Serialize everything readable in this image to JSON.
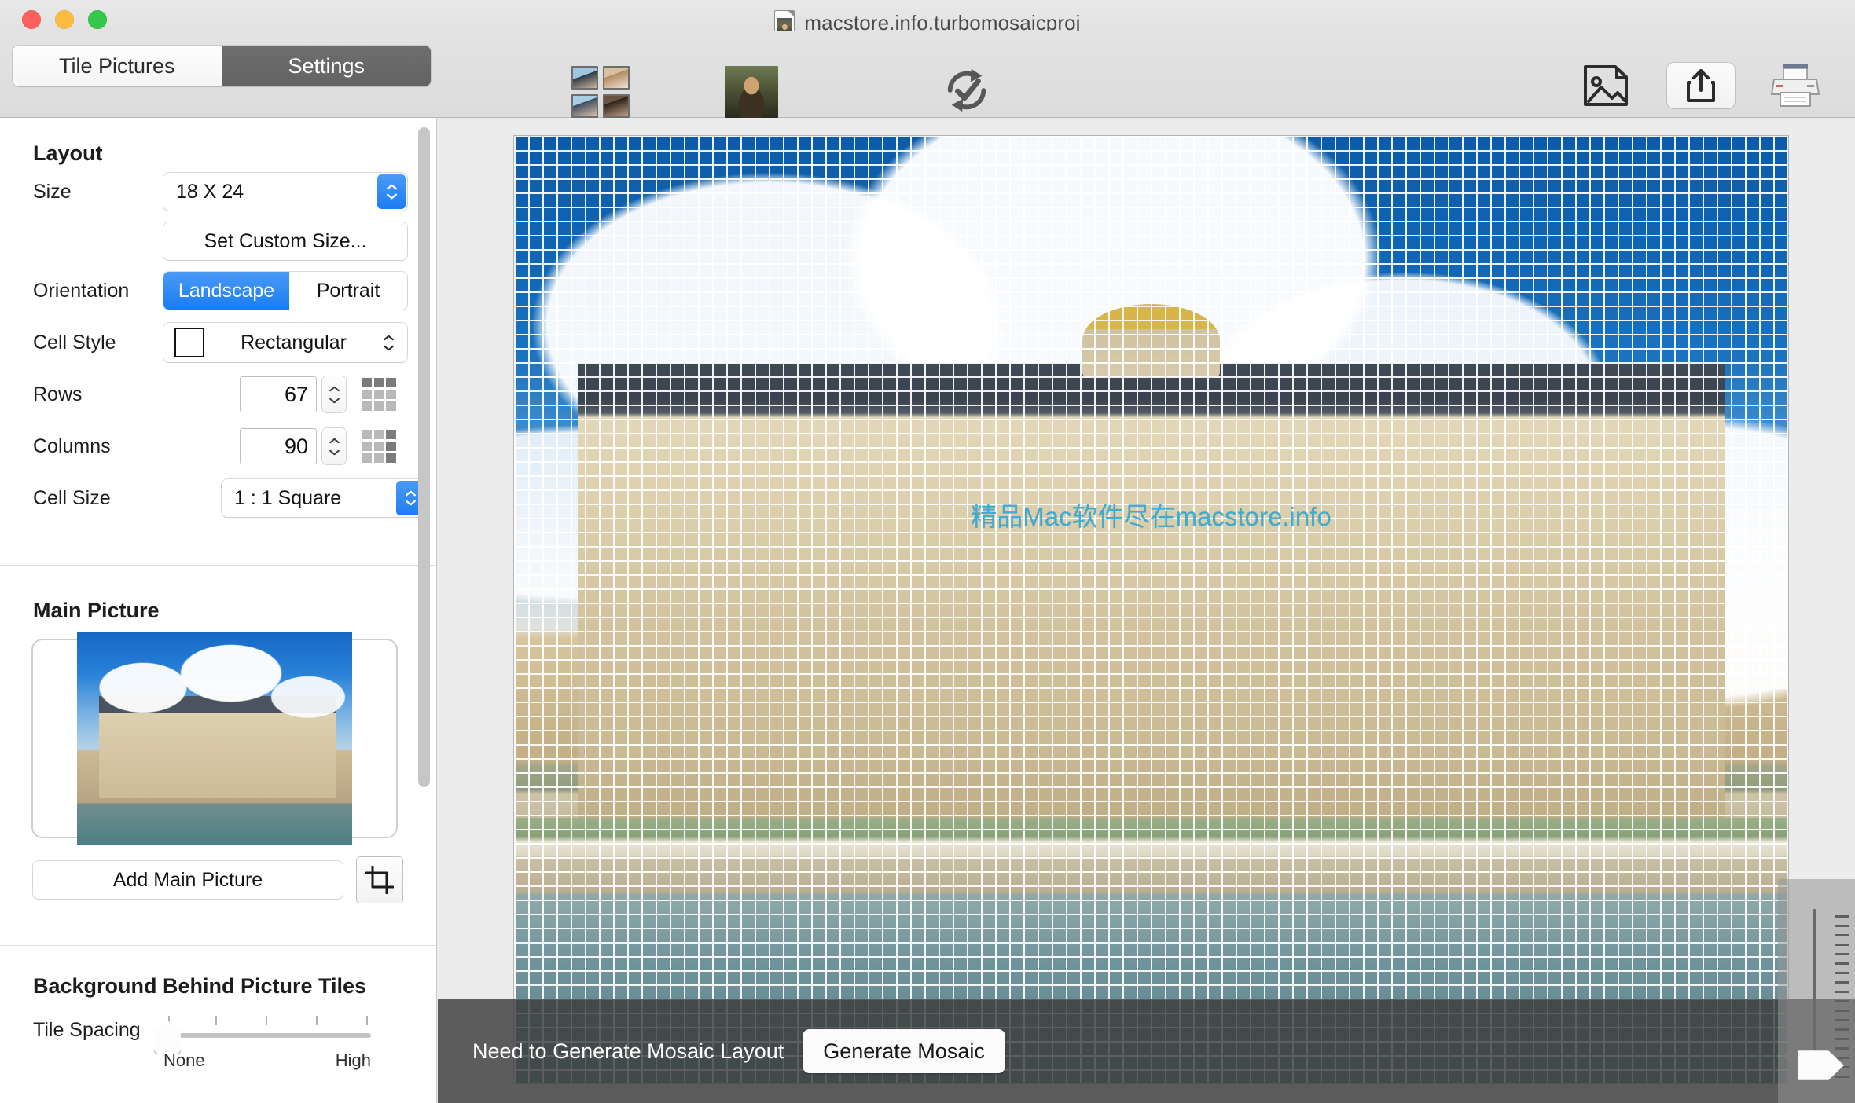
{
  "window": {
    "document_title": "macstore.info.turbomosaicproj",
    "traffic_lights": [
      "close-button",
      "minimize-button",
      "zoom-button"
    ]
  },
  "tabs": [
    {
      "label": "Tile Pictures",
      "active": false
    },
    {
      "label": "Settings",
      "active": true
    }
  ],
  "toolbar": {
    "items": [
      {
        "label": "Add Tile Pictures",
        "icon": "tile-pictures-icon"
      },
      {
        "label": "Add Main Picture",
        "icon": "mona-lisa-icon"
      },
      {
        "label": "Generate Mosaic",
        "icon": "generate-mosaic-icon"
      }
    ],
    "right_items": [
      {
        "label": "Export",
        "icon": "export-image-icon"
      },
      {
        "label": "Share",
        "icon": "share-icon"
      },
      {
        "label": "Print",
        "icon": "printer-icon"
      }
    ]
  },
  "sidebar": {
    "layout": {
      "title": "Layout",
      "size_label": "Size",
      "size_value": "18 X 24",
      "custom_size_button": "Set Custom Size...",
      "orientation_label": "Orientation",
      "orientation_options": [
        "Landscape",
        "Portrait"
      ],
      "orientation_selected": "Landscape",
      "cell_style_label": "Cell Style",
      "cell_style_value": "Rectangular",
      "rows_label": "Rows",
      "rows_value": "67",
      "columns_label": "Columns",
      "columns_value": "90",
      "cell_size_label": "Cell Size",
      "cell_size_value": "1 : 1 Square"
    },
    "main_picture": {
      "title": "Main Picture",
      "add_button": "Add Main Picture",
      "crop_button_icon": "crop-icon"
    },
    "background": {
      "title": "Background Behind Picture Tiles",
      "tile_spacing_label": "Tile Spacing",
      "slider_min_label": "None",
      "slider_max_label": "High",
      "slider_value": 0
    }
  },
  "canvas": {
    "watermark": "精品Mac软件尽在macstore.info",
    "status_text": "Need to Generate Mosaic Layout",
    "generate_button": "Generate Mosaic"
  },
  "colors": {
    "accent_blue": "#1d7df2",
    "tab_active_bg": "#6a6a6a",
    "watermark_blue": "#29a8d8",
    "status_overlay": "rgba(60,60,60,0.82)"
  }
}
